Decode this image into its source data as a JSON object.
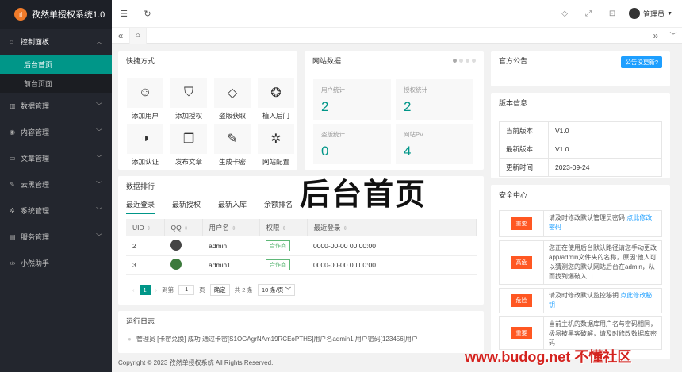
{
  "app": {
    "logo_text": "孜然单授权系统1.0",
    "logo_glyph": "ıl"
  },
  "sidebar": {
    "items": [
      {
        "label": "控制面板",
        "icon": "home-icon",
        "open": true,
        "children": [
          "后台首页",
          "前台页面"
        ],
        "active_child": 0
      },
      {
        "label": "数据管理",
        "icon": "chart-icon"
      },
      {
        "label": "内容管理",
        "icon": "compass-icon"
      },
      {
        "label": "文章管理",
        "icon": "book-icon"
      },
      {
        "label": "云黑管理",
        "icon": "brush-icon"
      },
      {
        "label": "系统管理",
        "icon": "gear-icon"
      },
      {
        "label": "服务管理",
        "icon": "server-icon"
      },
      {
        "label": "小然助手",
        "icon": "code-icon"
      }
    ]
  },
  "header": {
    "user_name": "管理员"
  },
  "quick": {
    "title": "快捷方式",
    "items": [
      {
        "label": "添加用户",
        "icon": "user-icon"
      },
      {
        "label": "添加授权",
        "icon": "shield-icon"
      },
      {
        "label": "盗版获取",
        "icon": "diamond-icon"
      },
      {
        "label": "植入后门",
        "icon": "palette-icon"
      },
      {
        "label": "添加认证",
        "icon": "compass-icon"
      },
      {
        "label": "发布文章",
        "icon": "book-icon"
      },
      {
        "label": "生成卡密",
        "icon": "edit-icon"
      },
      {
        "label": "网站配置",
        "icon": "gear-icon"
      }
    ]
  },
  "stats": {
    "title": "网站数据",
    "items": [
      {
        "label": "用户统计",
        "value": "2"
      },
      {
        "label": "授权统计",
        "value": "2"
      },
      {
        "label": "盗版统计",
        "value": "0"
      },
      {
        "label": "网站PV",
        "value": "4"
      }
    ]
  },
  "notice": {
    "title": "官方公告",
    "button": "公告没更新?"
  },
  "version": {
    "title": "版本信息",
    "rows": [
      {
        "k": "当前版本",
        "v": "V1.0"
      },
      {
        "k": "最新版本",
        "v": "V1.0"
      },
      {
        "k": "更新时间",
        "v": "2023-09-24"
      }
    ]
  },
  "rank": {
    "title": "数据排行",
    "tabs": [
      "最近登录",
      "最新授权",
      "最新入库",
      "余额排名"
    ],
    "columns": [
      "UID",
      "QQ",
      "用户名",
      "权限",
      "最近登录"
    ],
    "rows": [
      {
        "uid": "2",
        "username": "admin",
        "role": "合作商",
        "last": "0000-00-00 00:00:00"
      },
      {
        "uid": "3",
        "username": "admin1",
        "role": "合作商",
        "last": "0000-00-00 00:00:00"
      }
    ],
    "pager": {
      "current": "1",
      "goto_label": "到第",
      "goto_value": "1",
      "page_label": "页",
      "confirm": "确定",
      "total": "共 2 条",
      "page_size": "10 条/页"
    }
  },
  "big_heading": "后台首页",
  "security": {
    "title": "安全中心",
    "items": [
      {
        "level": "重要",
        "text": "请及时修改默认管理员密码 ",
        "link": "点此修改密码"
      },
      {
        "level": "高危",
        "text": "您正在使用后台默认路径请您手动更改app/admin文件夹的名称，原因:他人可以猜测您的默认网站后台在admin，从而找到爆破入口",
        "link": ""
      },
      {
        "level": "危险",
        "text": "请及时修改默认监控秘钥 ",
        "link": "点此修改秘钥"
      },
      {
        "level": "重要",
        "text": "当前主机的数据库用户名与密码相同，极易被黑客破解，请及时修改数据库密码",
        "link": ""
      }
    ]
  },
  "logs": {
    "title": "运行日志",
    "entries": [
      "管理员 [卡密兑换] 成功 通过卡密[S1OGAgrNAm19RCEoPTHS]用户名admin1|用户密码[123456]用户"
    ]
  },
  "footer": "Copyright © 2023 孜然单授权系统 All Rights Reserved.",
  "watermark": "www.budog.net 不懂社区"
}
